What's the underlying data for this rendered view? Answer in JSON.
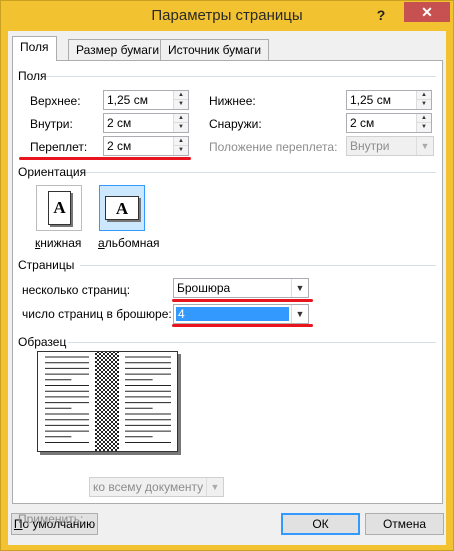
{
  "window": {
    "title": "Параметры страницы",
    "help_glyph": "?",
    "close_glyph": "✕"
  },
  "tabs": [
    {
      "label": "Поля",
      "active": true
    },
    {
      "label": "Размер бумаги",
      "active": false
    },
    {
      "label": "Источник бумаги",
      "active": false
    }
  ],
  "margins": {
    "group_label": "Поля",
    "top_label": "Верхнее:",
    "top_value": "1,25 см",
    "bottom_label": "Нижнее:",
    "bottom_value": "1,25 см",
    "inside_label": "Внутри:",
    "inside_value": "2 см",
    "outside_label": "Снаружи:",
    "outside_value": "2 см",
    "gutter_label": "Переплет:",
    "gutter_value": "2 см",
    "gutter_pos_label": "Положение переплета:",
    "gutter_pos_value": "Внутри"
  },
  "orientation": {
    "group_label": "Ориентация",
    "portrait_label": "книжная",
    "landscape_label": "альбомная",
    "glyph": "A"
  },
  "pages": {
    "group_label": "Страницы",
    "multiple_label": "несколько страниц:",
    "multiple_value": "Брошюра",
    "booklet_label": "число страниц в брошюре:",
    "booklet_value": "4"
  },
  "preview": {
    "group_label": "Образец"
  },
  "apply": {
    "label": "Применить:",
    "value": "ко всему документу"
  },
  "buttons": {
    "default_label": "По умолчанию",
    "ok_label": "ОК",
    "cancel_label": "Отмена"
  },
  "colors": {
    "title_bar": "#f2c230",
    "close_button": "#c75050",
    "selection": "#3399ff",
    "annotation_underline": "#e8141e"
  }
}
